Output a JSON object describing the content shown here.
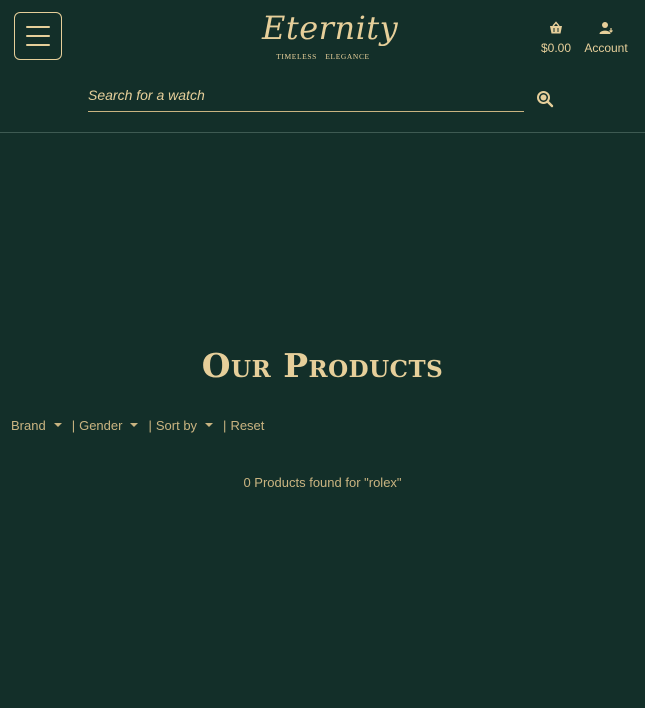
{
  "header": {
    "logo_name": "Eternity",
    "logo_tagline": "TIMELESS ELEGANCE",
    "cart_total": "$0.00",
    "account_label": "Account",
    "icons": [
      "menu-icon",
      "cart-icon",
      "account-icon",
      "search-icon"
    ]
  },
  "search": {
    "placeholder": "Search for a watch",
    "value": ""
  },
  "main": {
    "title": "Our Products",
    "filters": {
      "brand": "Brand",
      "gender": "Gender",
      "sort": "Sort by",
      "reset": "Reset",
      "separator": "|"
    },
    "result_text": "0 Products found for \"rolex\""
  },
  "colors": {
    "background": "#132f29",
    "accent": "#e6cf9a"
  }
}
